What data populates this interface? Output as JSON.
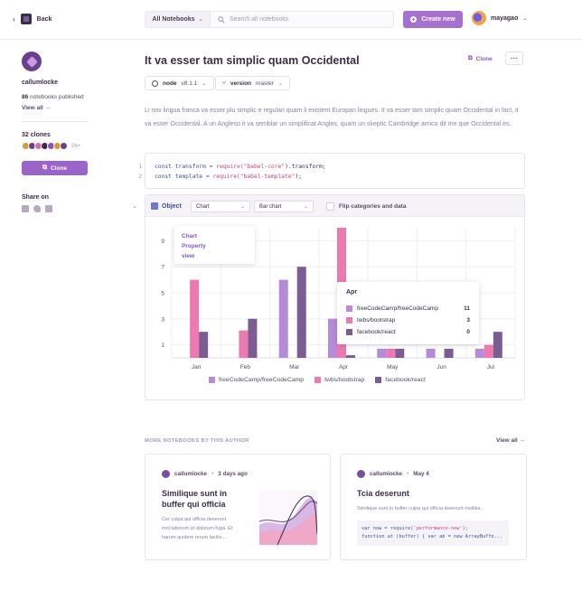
{
  "topbar": {
    "back_label": "Back",
    "notebooks_select": "All Notebooks",
    "search_placeholder": "Search all notebooks",
    "create_label": "Create new",
    "username": "mayagao"
  },
  "sidebar": {
    "author": "callumlocke",
    "notebooks_count": "86",
    "notebooks_label": "notebooks published",
    "view_all": "View all",
    "clones_label": "32 clones",
    "clones_more": "26+",
    "clone_button": "Clone",
    "share_label": "Share on",
    "share_icons": [
      "linkedin-icon",
      "twitter-icon",
      "facebook-icon"
    ]
  },
  "notebook": {
    "title": "It va esser tam simplic quam Occidental",
    "clone_label": "Clone",
    "more_label": "···",
    "node_key": "node",
    "node_value": "v8.1.1",
    "version_key": "version",
    "version_value": "master",
    "paragraph": "Li nov lingua franca va esser plu simplic e regulari quam li existent Europan lingues. It va esser tam simplic quam Occidental in fact, it va esser Occidental. A un Angleso it va semblar un simplificat Angles, quam un skeptic Cambridge amico dit me que Occidental es.",
    "code": [
      {
        "num": "1",
        "pre": "const transform = ",
        "fn": "require(",
        "str": "\"babel-core\"",
        "post": ").transform;"
      },
      {
        "num": "2",
        "pre": "const template = ",
        "fn": "require(",
        "str": "\"babel-template\"",
        "post": ");"
      }
    ]
  },
  "cell": {
    "object_label": "Object",
    "select_chart": "Chart",
    "select_type": "Bar chart",
    "flip_label": "Flip categories and data",
    "tooltip_left": [
      "Chart",
      "Property",
      "view"
    ],
    "tooltip_right": {
      "title": "Apr",
      "rows": [
        {
          "name": "freeCodeCamp/freeCodeCamp",
          "value": "11"
        },
        {
          "name": "twbs/bootstrap",
          "value": "3"
        },
        {
          "name": "facebook/react",
          "value": "0"
        }
      ]
    }
  },
  "colors": {
    "accent": "#a66fd0",
    "series1": "#b58ad8",
    "series2": "#ec79b0",
    "series3": "#7c5d93"
  },
  "chart_data": {
    "type": "bar",
    "categories": [
      "Jan",
      "Feb",
      "Mar",
      "Apr",
      "May",
      "Jun",
      "Jul"
    ],
    "yticks": [
      "1",
      "3",
      "5",
      "7",
      "9"
    ],
    "ylim": [
      0,
      10
    ],
    "series": [
      {
        "name": "freeCodeCamp/freeCodeCamp",
        "values": [
          0,
          0,
          6,
          3,
          0.7,
          0.7,
          0.7
        ]
      },
      {
        "name": "twbs/bootstrap",
        "values": [
          6,
          2.1,
          0,
          10,
          0.7,
          0,
          1
        ]
      },
      {
        "name": "facebook/react",
        "values": [
          2,
          3,
          7,
          0.2,
          0.7,
          0.7,
          2
        ]
      }
    ],
    "legend": "bottom",
    "grid": true
  },
  "more": {
    "heading": "MORE NOTEBOOKS BY THIS AUTHOR",
    "view_all": "View all",
    "cards": [
      {
        "author": "callumlocke",
        "when": "3 days ago",
        "title_line1": "Similique sunt in",
        "title_line2": "buffer qui officia",
        "desc_line1": "Cer culpa qui officia deserunt",
        "desc_line2": "mol laborum et dolorum fuga. Et",
        "desc_line3": "harum quidem rerum facilis..."
      },
      {
        "author": "callumlocke",
        "when": "May 4",
        "title": "Tcia deserunt",
        "desc": "Similique sunt in buffer culpa qui officia deserunt mollitia.",
        "code_line1_pre": "var now = require(",
        "code_line1_str": "'performance-now'",
        "code_line1_post": ");",
        "code_line2": "function at (buffer) { var ab = new ArrayBuffe..."
      }
    ]
  }
}
